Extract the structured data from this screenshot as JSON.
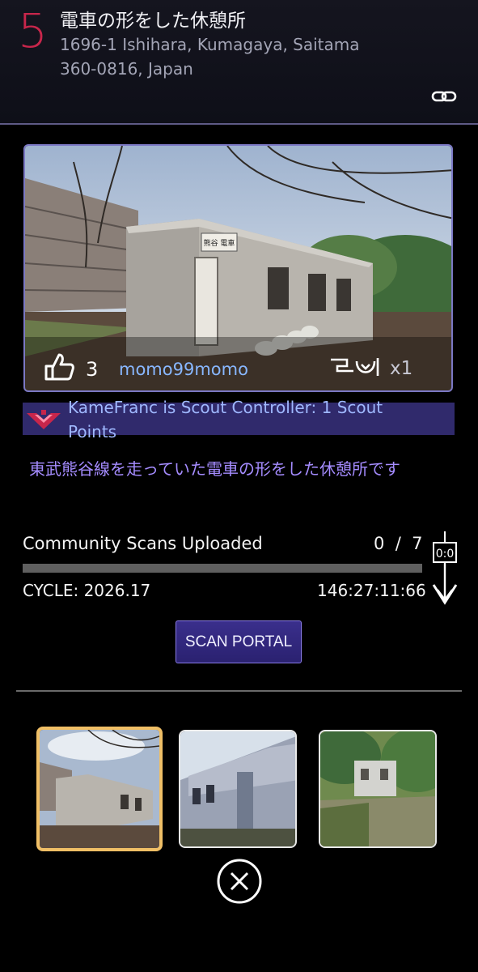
{
  "portal": {
    "level": "5",
    "title": "電車の形をした休憩所",
    "address": "1696-1 Ishihara, Kumagaya, Saitama 360-0816, Japan"
  },
  "photo": {
    "likes": "3",
    "uploader": "momo99momo",
    "scan_multiplier": "x1",
    "sign_text": "熊谷 電車"
  },
  "scout": {
    "text": "KameFranc is Scout Controller: 1 Scout Points"
  },
  "description": "東武熊谷線を走っていた電車の形をした休憩所です",
  "community_scans": {
    "label": "Community Scans Uploaded",
    "count": "0  /  7",
    "progress": 0,
    "cycle_label": "CYCLE: 2026.17",
    "cycle_timer": "146:27:11:66",
    "timer_icon_text": "0:0"
  },
  "scan_button": "SCAN PORTAL",
  "thumbnails": [
    {
      "name": "photo-1",
      "selected": true
    },
    {
      "name": "photo-2",
      "selected": false
    },
    {
      "name": "photo-3",
      "selected": false
    }
  ],
  "colors": {
    "level": "#c8264b",
    "uploader": "#88b7ff",
    "description": "#a58cff",
    "accent_border": "#7b78c4",
    "selected_thumb": "#f0bf66"
  },
  "icons": [
    "link-icon",
    "thumbs-up-icon",
    "scan-icon",
    "scout-controller-icon",
    "cycle-timer-icon",
    "close-icon"
  ]
}
